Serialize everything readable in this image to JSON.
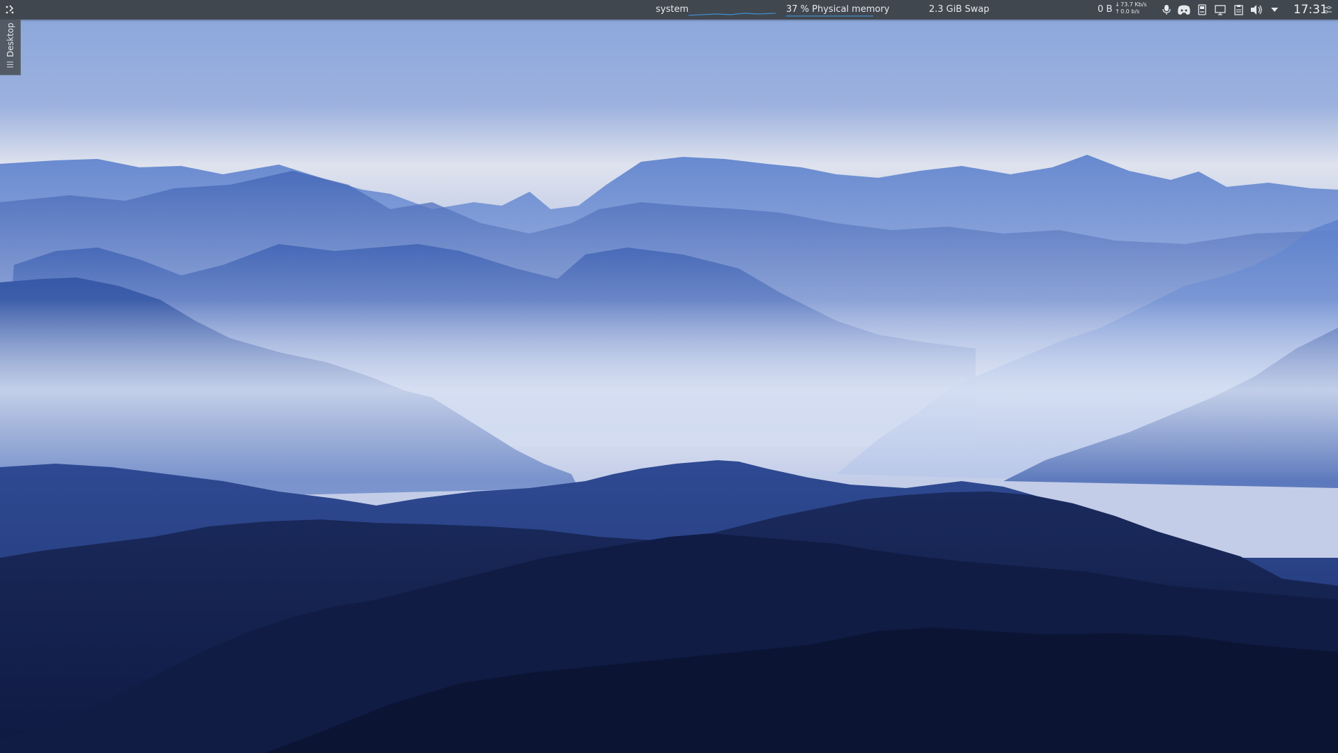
{
  "panel": {
    "launcher_icon": "application-launcher-icon",
    "system_monitor": {
      "cpu_label": "system",
      "memory_label": "37 % Physical memory",
      "swap_label": "2.3 GiB  Swap",
      "graph_color": "#3e8ed0"
    },
    "network": {
      "total_label": "0 B",
      "download_speed": "73.7 Kb/s",
      "upload_speed": "0.0 b/s",
      "download_arrow": "↓",
      "upload_arrow": "↑"
    },
    "tray_icons": [
      "microphone-icon",
      "discord-icon",
      "removable-device-icon",
      "display-icon",
      "clipboard-icon",
      "volume-icon",
      "expand-tray-icon"
    ],
    "clock": "17:31",
    "panel_settings_icon": "panel-settings-icon"
  },
  "desktop_toolbox": {
    "label": "Desktop",
    "menu_icon": "hamburger-menu-icon"
  },
  "wallpaper": {
    "description_icon": "mountain-wallpaper",
    "colors": {
      "sky_top": "#8aa6dc",
      "sky_horizon": "#dfe3ee",
      "mist": "#c9d3ea",
      "far_ridges": "#5a7fcc",
      "mid_ridges": "#3d5fae",
      "near_ridges": "#21356e",
      "foreground": "#0d1636"
    }
  }
}
